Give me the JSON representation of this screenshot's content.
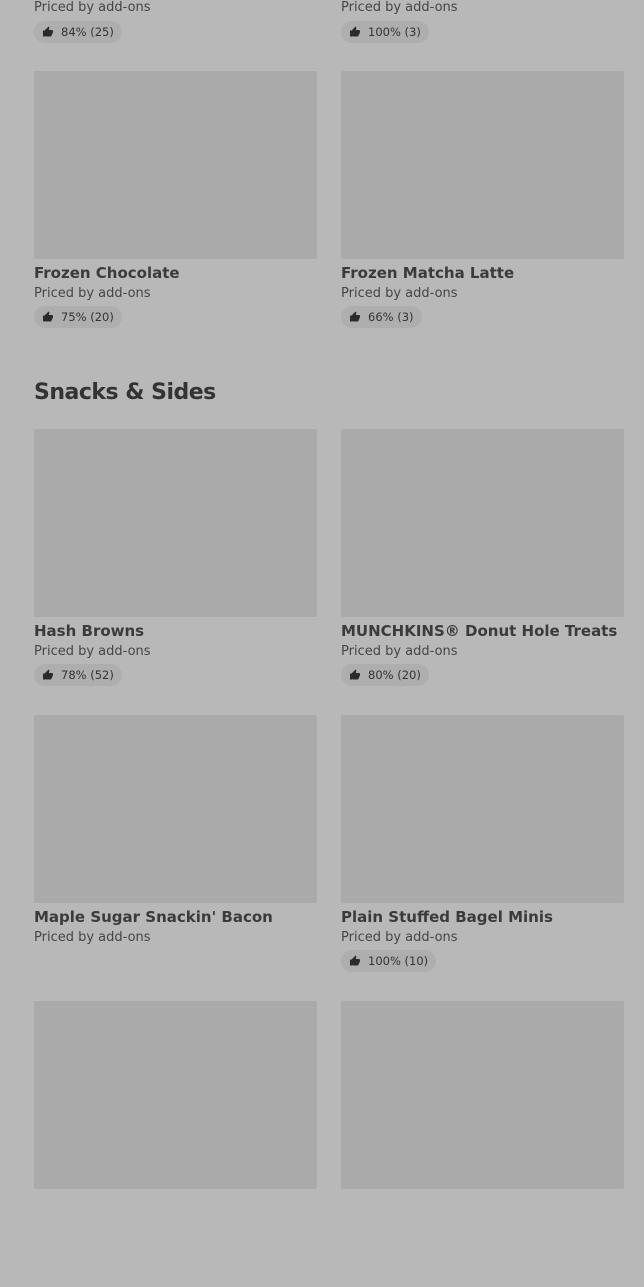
{
  "top_partial": [
    {
      "price": "Priced by add-ons",
      "rating": "84% (25)"
    },
    {
      "price": "Priced by add-ons",
      "rating": "100% (3)"
    }
  ],
  "drinks": [
    {
      "name": "Frozen Chocolate",
      "price": "Priced by add-ons",
      "rating": "75% (20)"
    },
    {
      "name": "Frozen Matcha Latte",
      "price": "Priced by add-ons",
      "rating": "66% (3)"
    }
  ],
  "snacks_section": {
    "title": "Snacks & Sides",
    "items": [
      {
        "name": "Hash Browns",
        "price": "Priced by add-ons",
        "rating": "78% (52)"
      },
      {
        "name": "MUNCHKINS® Donut Hole Treats",
        "price": "Priced by add-ons",
        "rating": "80% (20)"
      },
      {
        "name": "Maple Sugar Snackin' Bacon",
        "price": "Priced by add-ons"
      },
      {
        "name": "Plain Stuffed Bagel Minis",
        "price": "Priced by add-ons",
        "rating": "100% (10)"
      }
    ]
  },
  "icons": {
    "rating": "thumbs-up-icon"
  }
}
